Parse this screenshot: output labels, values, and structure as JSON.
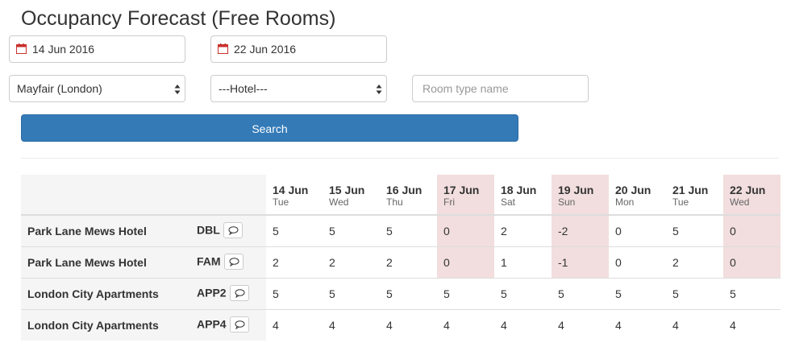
{
  "page": {
    "title": "Occupancy Forecast (Free Rooms)"
  },
  "filters": {
    "date_from": {
      "value": "14 Jun 2016",
      "icon": "calendar-icon"
    },
    "date_to": {
      "value": "22 Jun 2016",
      "icon": "calendar-icon"
    },
    "location_select": {
      "value": "Mayfair (London)"
    },
    "hotel_select": {
      "value": "---Hotel---"
    },
    "room_type": {
      "placeholder": "Room type name",
      "value": ""
    },
    "search_label": "Search"
  },
  "colors": {
    "accent": "#337ab7",
    "alert": "#f2dede"
  },
  "table": {
    "days": [
      {
        "date": "14 Jun",
        "name": "Tue",
        "alert": false
      },
      {
        "date": "15 Jun",
        "name": "Wed",
        "alert": false
      },
      {
        "date": "16 Jun",
        "name": "Thu",
        "alert": false
      },
      {
        "date": "17 Jun",
        "name": "Fri",
        "alert": true
      },
      {
        "date": "18 Jun",
        "name": "Sat",
        "alert": false
      },
      {
        "date": "19 Jun",
        "name": "Sun",
        "alert": true
      },
      {
        "date": "20 Jun",
        "name": "Mon",
        "alert": false
      },
      {
        "date": "21 Jun",
        "name": "Tue",
        "alert": false
      },
      {
        "date": "22 Jun",
        "name": "Wed",
        "alert": true
      }
    ],
    "rows": [
      {
        "hotel": "Park Lane Mews Hotel",
        "room_type": "DBL",
        "values": [
          "5",
          "5",
          "5",
          "0",
          "2",
          "-2",
          "0",
          "5",
          "0"
        ]
      },
      {
        "hotel": "Park Lane Mews Hotel",
        "room_type": "FAM",
        "values": [
          "2",
          "2",
          "2",
          "0",
          "1",
          "-1",
          "0",
          "2",
          "0"
        ]
      },
      {
        "hotel": "London City Apartments",
        "room_type": "APP2",
        "values": [
          "5",
          "5",
          "5",
          "5",
          "5",
          "5",
          "5",
          "5",
          "5"
        ]
      },
      {
        "hotel": "London City Apartments",
        "room_type": "APP4",
        "values": [
          "4",
          "4",
          "4",
          "4",
          "4",
          "4",
          "4",
          "4",
          "4"
        ]
      }
    ]
  }
}
